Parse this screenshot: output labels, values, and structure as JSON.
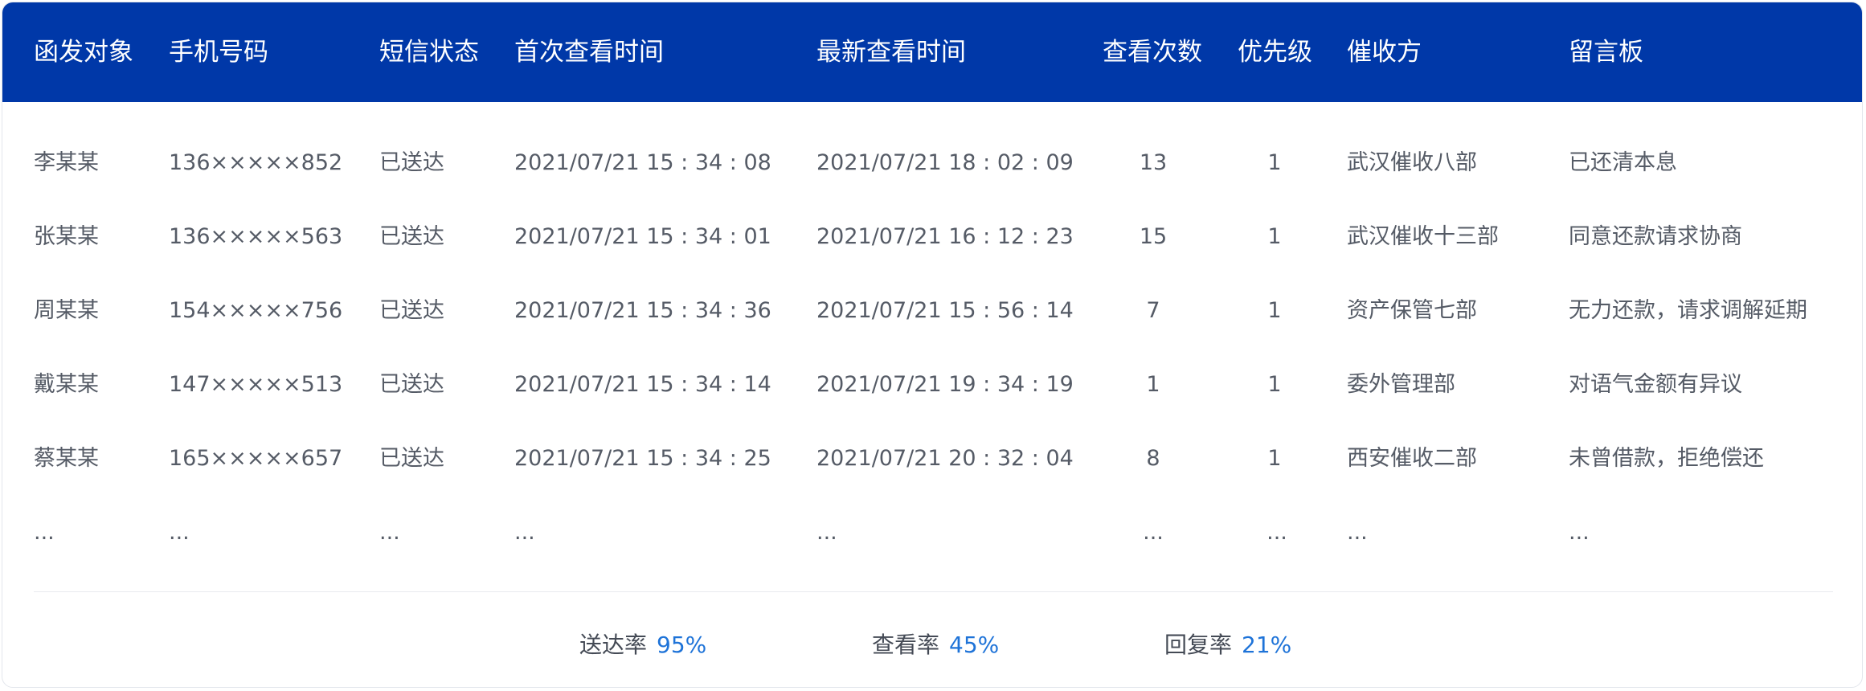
{
  "headers": [
    "函发对象",
    "手机号码",
    "短信状态",
    "首次查看时间",
    "最新查看时间",
    "查看次数",
    "优先级",
    "催收方",
    "留言板"
  ],
  "rows": [
    [
      "李某某",
      "136×××××852",
      "已送达",
      "2021/07/21  15 : 34 : 08",
      "2021/07/21  18 : 02 : 09",
      "13",
      "1",
      "武汉催收八部",
      "已还清本息"
    ],
    [
      "张某某",
      "136×××××563",
      "已送达",
      "2021/07/21  15 : 34 : 01",
      "2021/07/21  16 : 12 : 23",
      "15",
      "1",
      "武汉催收十三部",
      "同意还款请求协商"
    ],
    [
      "周某某",
      "154×××××756",
      "已送达",
      "2021/07/21  15 : 34 : 36",
      "2021/07/21  15 : 56 : 14",
      "7",
      "1",
      "资产保管七部",
      "无力还款，请求调解延期"
    ],
    [
      "戴某某",
      "147×××××513",
      "已送达",
      "2021/07/21  15 : 34 : 14",
      "2021/07/21  19 : 34 : 19",
      "1",
      "1",
      "委外管理部",
      "对语气金额有异议"
    ],
    [
      "蔡某某",
      "165×××××657",
      "已送达",
      "2021/07/21  15 : 34 : 25",
      "2021/07/21  20 : 32 : 04",
      "8",
      "1",
      "西安催收二部",
      "未曾借款，拒绝偿还"
    ],
    [
      "...",
      "...",
      "...",
      "...",
      "...",
      "...",
      "...",
      "...",
      "..."
    ]
  ],
  "stats": [
    {
      "label": "送达率",
      "value": "95%"
    },
    {
      "label": "查看率",
      "value": "45%"
    },
    {
      "label": "回复率",
      "value": "21%"
    }
  ],
  "colors": {
    "header_bg": "#0038a8",
    "header_text": "#ffffff",
    "cell_text": "#555b66",
    "accent": "#1e73d8"
  }
}
